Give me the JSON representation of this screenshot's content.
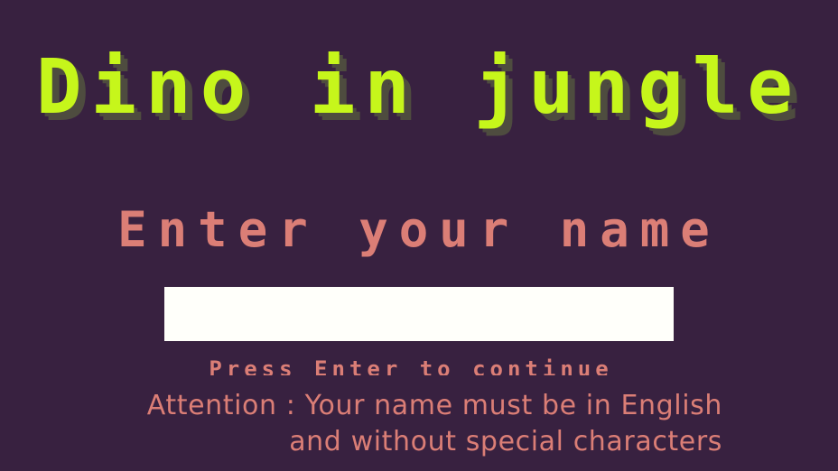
{
  "title": "Dino in jungle",
  "prompt": {
    "heading": "Enter your name",
    "input_value": "",
    "hint": "Press Enter to continue"
  },
  "attention": {
    "line1": "Attention : Your name must be in English",
    "line2": "and without special characters"
  },
  "colors": {
    "background": "#382140",
    "title": "#c6f61b",
    "title_shadow": "#4e4c3f",
    "text": "#db7e76",
    "input_background": "#fffffa"
  }
}
